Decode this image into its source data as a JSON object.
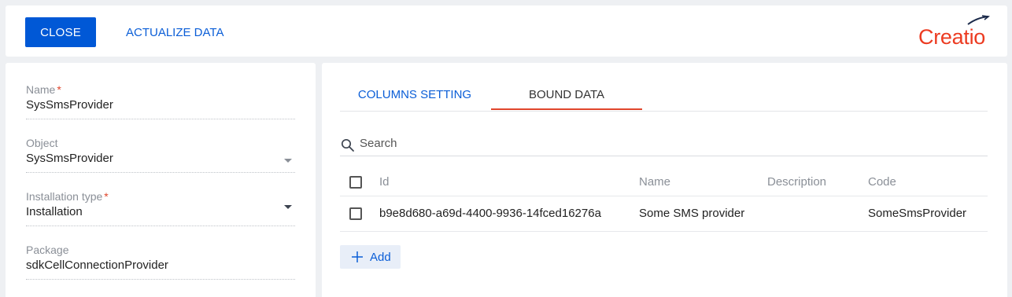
{
  "toolbar": {
    "close_label": "CLOSE",
    "actualize_label": "ACTUALIZE DATA",
    "logo_text": "Creatio",
    "logo_color": "#ec3b21"
  },
  "form": {
    "name": {
      "label": "Name",
      "required_mark": "*",
      "value": "SysSmsProvider"
    },
    "object": {
      "label": "Object",
      "value": "SysSmsProvider"
    },
    "installation_type": {
      "label": "Installation type",
      "required_mark": "*",
      "value": "Installation"
    },
    "package": {
      "label": "Package",
      "value": "sdkCellConnectionProvider"
    }
  },
  "tabs": [
    {
      "label": "COLUMNS SETTING",
      "active": false
    },
    {
      "label": "BOUND DATA",
      "active": true
    }
  ],
  "search": {
    "placeholder": "Search",
    "value": ""
  },
  "grid": {
    "columns": [
      "Id",
      "Name",
      "Description",
      "Code"
    ],
    "rows": [
      {
        "id": "b9e8d680-a69d-4400-9936-14fced16276a",
        "name": "Some SMS provider",
        "description": "",
        "code": "SomeSmsProvider"
      }
    ]
  },
  "add_label": "Add",
  "colors": {
    "accent": "#0058d6",
    "link": "#0b5ed7",
    "active_tab_underline": "#e0452c",
    "required": "#e0452c"
  }
}
